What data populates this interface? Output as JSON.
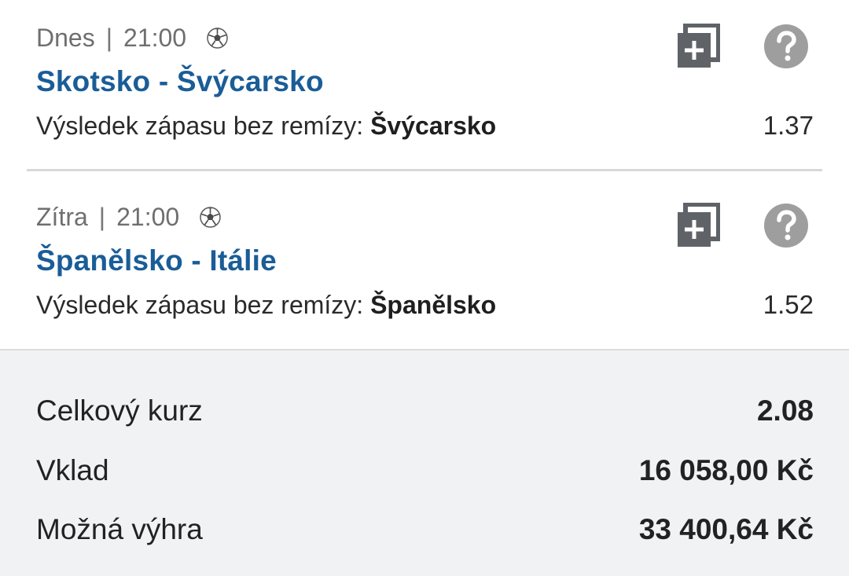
{
  "bets": [
    {
      "day": "Dnes",
      "separator": "|",
      "time": "21:00",
      "sport_icon": "soccer-ball-icon",
      "match": "Skotsko - Švýcarsko",
      "market_label": "Výsledek zápasu bez remízy:",
      "selection": "Švýcarsko",
      "odd": "1.37",
      "copy_icon": "copy-add-icon",
      "help_icon": "help-icon"
    },
    {
      "day": "Zítra",
      "separator": "|",
      "time": "21:00",
      "sport_icon": "soccer-ball-icon",
      "match": "Španělsko - Itálie",
      "market_label": "Výsledek zápasu bez remízy:",
      "selection": "Španělsko",
      "odd": "1.52",
      "copy_icon": "copy-add-icon",
      "help_icon": "help-icon"
    }
  ],
  "summary": {
    "total_odds_label": "Celkový kurz",
    "total_odds_value": "2.08",
    "stake_label": "Vklad",
    "stake_value": "16 058,00 Kč",
    "win_label": "Možná výhra",
    "win_value": "33 400,64 Kč"
  },
  "colors": {
    "match_title": "#1a5d97",
    "icon_gray": "#5f6368",
    "help_circle": "#9e9e9e",
    "summary_bg": "#f1f2f3"
  }
}
